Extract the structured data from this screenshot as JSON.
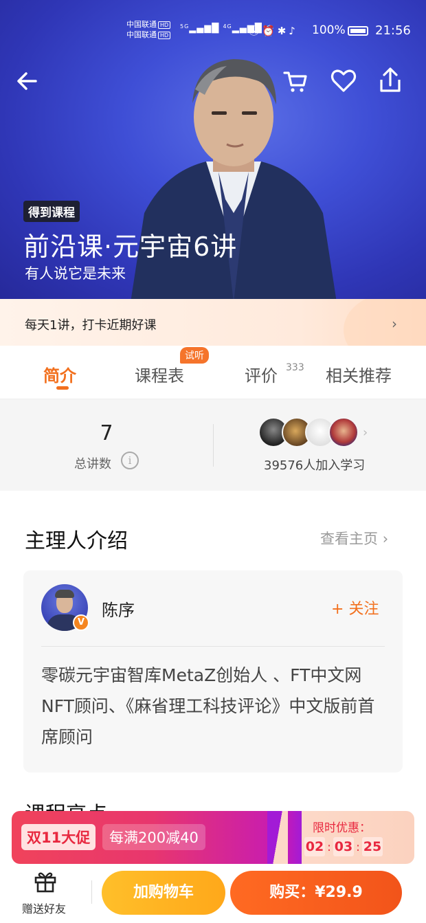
{
  "status_bar": {
    "carrier_1": "中国联通",
    "carrier_2": "中国联通",
    "hd": "HD",
    "network_1": "5G",
    "network_2": "4G",
    "battery": "100%",
    "time": "21:56"
  },
  "nav": {
    "icons": [
      "back-arrow-icon",
      "cart-icon",
      "heart-icon",
      "share-icon"
    ]
  },
  "hero": {
    "brand_tag": "得到课程",
    "title": "前沿课·元宇宙6讲",
    "subtitle": "有人说它是未来"
  },
  "daily_banner": {
    "text": "每天1讲，打卡近期好课"
  },
  "tabs": [
    {
      "label": "简介",
      "active": true
    },
    {
      "label": "课程表",
      "badge": "试听"
    },
    {
      "label": "评价",
      "count": "333"
    },
    {
      "label": "相关推荐"
    }
  ],
  "stats": {
    "lecture_count": "7",
    "lecture_label": "总讲数",
    "learners_text": "39576人加入学习"
  },
  "host_section": {
    "title": "主理人介绍",
    "homepage_link": "查看主页",
    "host_name": "陈序",
    "follow_label": "关注",
    "bio": "零碳元宇宙智库MetaZ创始人 、FT中文网NFT顾问、《麻省理工科技评论》中文版前首席顾问"
  },
  "next_section": {
    "title": "课程亮点"
  },
  "promo": {
    "event": "双11大促",
    "offer": "每满200减40",
    "limited_label": "限时优惠：",
    "countdown": {
      "hours": "02",
      "minutes": "03",
      "seconds": "25"
    }
  },
  "bottom_bar": {
    "gift_label": "赠送好友",
    "add_to_cart": "加购物车",
    "buy": "购买：¥29.9"
  },
  "colors": {
    "accent": "#f2701e",
    "hero_blue": "#3f4fd6",
    "promo_red": "#e8283f",
    "cart_yellow": "#ffae1f"
  }
}
